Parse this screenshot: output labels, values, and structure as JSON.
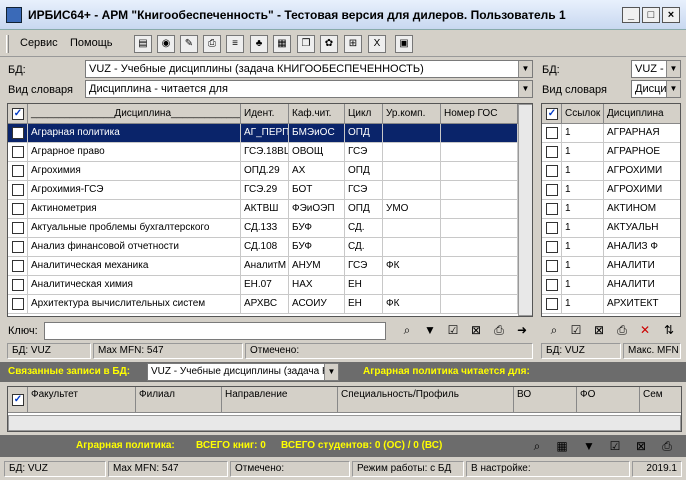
{
  "window": {
    "title": "ИРБИС64+ - АРМ \"Книгообеспеченность\" - Тестовая версия для дилеров. Пользователь 1"
  },
  "menu": {
    "items": [
      "Сервис",
      "Помощь"
    ]
  },
  "main_panel": {
    "db_label": "БД:",
    "db_value": "VUZ - Учебные дисциплины (задача КНИГООБЕСПЕЧЕННОСТЬ)",
    "dict_label": "Вид словаря",
    "dict_value": "Дисциплина - читается для",
    "columns": [
      "_______________Дисциплина_____________",
      "Идент.",
      "Каф.чит.",
      "Цикл",
      "Ур.комп.",
      "Номер ГОС"
    ],
    "rows": [
      [
        "Аграрная политика",
        "АГ_ПЕРП",
        "БМЭиОС",
        "ОПД",
        "",
        ""
      ],
      [
        "Аграрное право",
        "ГСЭ.18ВЦ",
        "ОВОЩ",
        "ГСЭ",
        "",
        ""
      ],
      [
        "Агрохимия",
        "ОПД.29",
        "АХ",
        "ОПД",
        "",
        ""
      ],
      [
        "Агрохимия-ГСЭ",
        "ГСЭ.29",
        "БОТ",
        "ГСЭ",
        "",
        ""
      ],
      [
        "Актинометрия",
        "АКТВШ",
        "ФЭиОЭП",
        "ОПД",
        "УМО",
        ""
      ],
      [
        "Актуальные проблемы бухгалтерского",
        "СД.133",
        "БУФ",
        "СД.",
        "",
        ""
      ],
      [
        "Анализ финансовой отчетности",
        "СД.108",
        "БУФ",
        "СД.",
        "",
        ""
      ],
      [
        "Аналитическая механика",
        "АналитМ",
        "АНУМ",
        "ГСЭ",
        "ФК",
        ""
      ],
      [
        "Аналитическая химия",
        "ЕН.07",
        "НАХ",
        "ЕН",
        "",
        ""
      ],
      [
        "Архитектура вычислительных систем",
        "АРХВС",
        "АСОИУ",
        "ЕН",
        "ФК",
        ""
      ]
    ],
    "key_label": "Ключ:",
    "key_value": "",
    "status": [
      "БД: VUZ",
      "Max MFN: 547",
      "Отмечено:"
    ]
  },
  "right_panel": {
    "db_label": "БД:",
    "db_value": "VUZ -",
    "dict_label": "Вид словаря",
    "dict_value": "Дисци",
    "columns": [
      "Ссылок",
      "Дисциплина"
    ],
    "rows": [
      [
        "1",
        "АГРАРНАЯ"
      ],
      [
        "1",
        "АГРАРНОЕ"
      ],
      [
        "1",
        "АГРОХИМИ"
      ],
      [
        "1",
        "АГРОХИМИ"
      ],
      [
        "1",
        "АКТИНОМ"
      ],
      [
        "1",
        "АКТУАЛЬН"
      ],
      [
        "1",
        "АНАЛИЗ Ф"
      ],
      [
        "1",
        "АНАЛИТИ"
      ],
      [
        "1",
        "АНАЛИТИ"
      ],
      [
        "1",
        "АРХИТЕКТ"
      ]
    ],
    "status": [
      "БД: VUZ",
      "Макс. MFN"
    ]
  },
  "linked": {
    "label": "Связанные записи в БД:",
    "db_value": "VUZ - Учебные дисциплины (задача КН",
    "reads_for": "Аграрная политика читается для:",
    "columns": [
      "Факультет",
      "Филиал",
      "Направление",
      "Специальность/Профиль",
      "ВО",
      "ФО",
      "Сем"
    ],
    "summary": {
      "discipline": "Аграрная политика:",
      "books": "ВСЕГО книг: 0",
      "students": "ВСЕГО студентов: 0 (ОС) / 0 (ВС)"
    }
  },
  "statusbar": [
    "БД: VUZ",
    "Max MFN: 547",
    "Отмечено:",
    "Режим работы: с БД",
    "В настройке:",
    "2019.1"
  ],
  "colors": {
    "selection": "#0a246a",
    "banner": "#6c6c6c",
    "highlight_text": "#ffff00"
  }
}
